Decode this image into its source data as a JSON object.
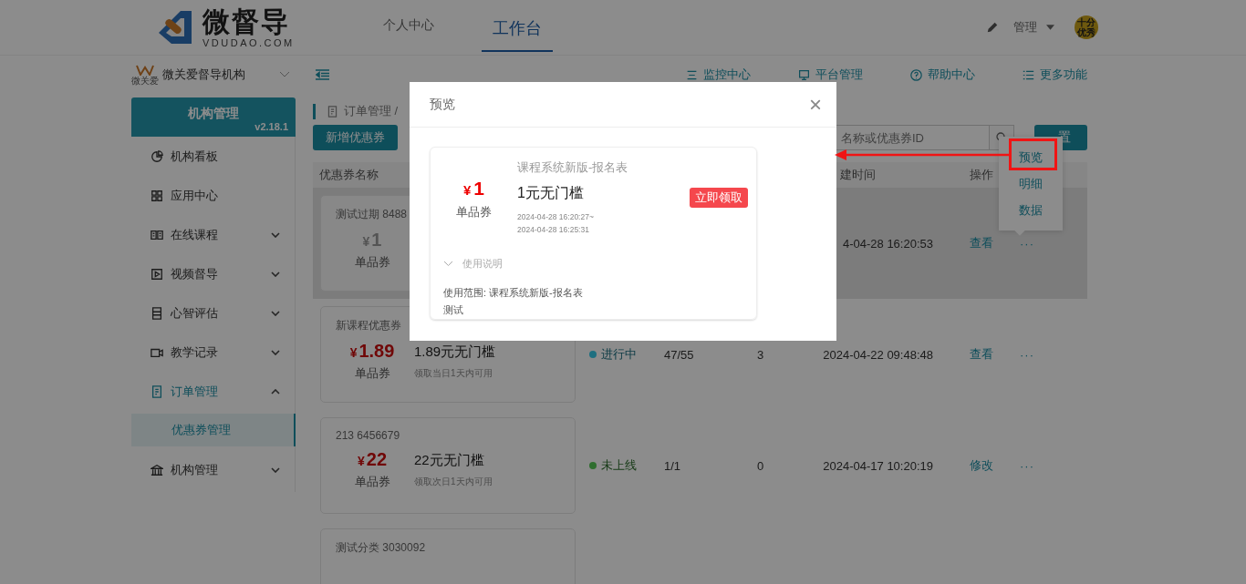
{
  "header": {
    "logo_title": "微督导",
    "logo_subtitle": "VDUDAO.COM",
    "nav": [
      {
        "label": "个人中心",
        "selected": false
      },
      {
        "label": "工作台",
        "selected": true
      }
    ],
    "user_menu": "管理",
    "avatar_lines": [
      "十分",
      "优秀"
    ]
  },
  "sidebar": {
    "org_caption": "微关爱",
    "org_name": "微关爱督导机构",
    "banner_title": "机构管理",
    "version": "v2.18.1",
    "items": [
      {
        "label": "机构看板",
        "kind": "link"
      },
      {
        "label": "应用中心",
        "kind": "link"
      },
      {
        "label": "在线课程",
        "kind": "group",
        "expanded": false
      },
      {
        "label": "视频督导",
        "kind": "group",
        "expanded": false
      },
      {
        "label": "心智评估",
        "kind": "group",
        "expanded": false
      },
      {
        "label": "教学记录",
        "kind": "group",
        "expanded": false
      },
      {
        "label": "订单管理",
        "kind": "group",
        "expanded": true,
        "children": [
          {
            "label": "优惠券管理",
            "selected": true
          }
        ]
      },
      {
        "label": "机构管理",
        "kind": "group",
        "expanded": false
      }
    ]
  },
  "toolbar": {
    "links": [
      "监控中心",
      "平台管理",
      "帮助中心",
      "更多功能"
    ]
  },
  "breadcrumb": "订单管理 /",
  "actions": {
    "add_button": "新增优惠券",
    "search_placeholder": "名称或优惠券ID",
    "reset_button": "置"
  },
  "table": {
    "column_1": "优惠券名称",
    "column_5": "建时间",
    "column_6": "操作",
    "rows": [
      {
        "title": "测试过期 8488",
        "currency": "¥",
        "amount": "1",
        "type": "单品券",
        "expired": true,
        "highlighted": true,
        "created": "4-04-28 16:20:53",
        "action": "查看",
        "more": "···"
      },
      {
        "title": "新课程优惠券",
        "currency": "¥",
        "amount": "1.89",
        "type": "单品券",
        "rule": "1.89元无门槛",
        "validity": "领取当日1天内可用",
        "expired": false,
        "highlighted": false,
        "status": {
          "label": "进行中",
          "color": "#1d6f80"
        },
        "claimed": "47/55",
        "used": "3",
        "created": "2024-04-22 09:48:48",
        "action": "查看",
        "more": "···"
      },
      {
        "title": "213 6456679",
        "currency": "¥",
        "amount": "22",
        "type": "单品券",
        "rule": "22元无门槛",
        "validity": "领取次日1天内可用",
        "expired": false,
        "highlighted": false,
        "status": {
          "label": "未上线",
          "color": "#2f6e2f"
        },
        "claimed": "1/1",
        "used": "0",
        "created": "2024-04-17 10:20:19",
        "action": "修改",
        "more": "···"
      },
      {
        "title": "测试分类 3030092",
        "highlighted": false
      }
    ]
  },
  "popover": {
    "items": [
      {
        "label": "预览",
        "annotated": true
      },
      {
        "label": "明细",
        "annotated": false
      },
      {
        "label": "数据",
        "annotated": false
      }
    ]
  },
  "modal": {
    "title": "预览",
    "close": "×",
    "coupon": {
      "currency": "¥",
      "amount": "1",
      "type": "单品券",
      "scope_title": "课程系统新版-报名表",
      "rule": "1元无门槛",
      "valid_from": "2024-04-28 16:20:27~",
      "valid_to": "2024-04-28 16:25:31",
      "claim_button": "立即领取",
      "instructions_label": "使用说明",
      "scope": "使用范围: 课程系统新版-报名表",
      "note": "测试"
    }
  }
}
